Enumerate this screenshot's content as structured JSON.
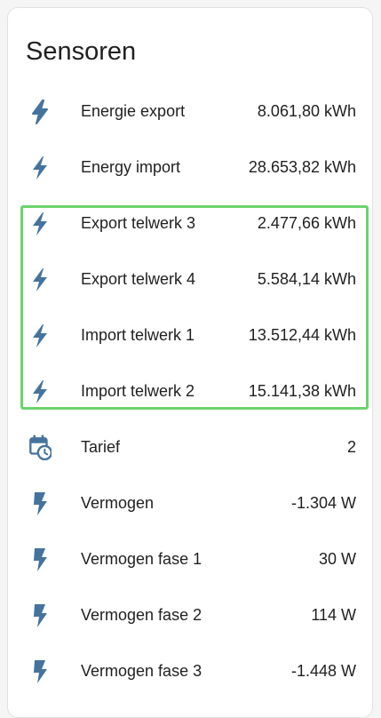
{
  "card": {
    "title": "Sensoren"
  },
  "colors": {
    "icon": "#44739e",
    "highlight_border": "#6cd36c",
    "text": "#212121"
  },
  "rows": [
    {
      "icon": "flash-icon",
      "label": "Energie export",
      "value": "8.061,80 kWh"
    },
    {
      "icon": "flash-icon",
      "label": "Energy import",
      "value": "28.653,82 kWh"
    },
    {
      "icon": "flash-icon",
      "label": "Export telwerk 3",
      "value": "2.477,66 kWh"
    },
    {
      "icon": "flash-icon",
      "label": "Export telwerk 4",
      "value": "5.584,14 kWh"
    },
    {
      "icon": "flash-icon",
      "label": "Import telwerk 1",
      "value": "13.512,44 kWh"
    },
    {
      "icon": "flash-icon",
      "label": "Import telwerk 2",
      "value": "15.141,38 kWh"
    },
    {
      "icon": "calendar-clock-icon",
      "label": "Tarief",
      "value": "2"
    },
    {
      "icon": "flash-solid-icon",
      "label": "Vermogen",
      "value": "-1.304 W"
    },
    {
      "icon": "flash-solid-icon",
      "label": "Vermogen fase 1",
      "value": "30 W"
    },
    {
      "icon": "flash-solid-icon",
      "label": "Vermogen fase 2",
      "value": "114 W"
    },
    {
      "icon": "flash-solid-icon",
      "label": "Vermogen fase 3",
      "value": "-1.448 W"
    }
  ]
}
